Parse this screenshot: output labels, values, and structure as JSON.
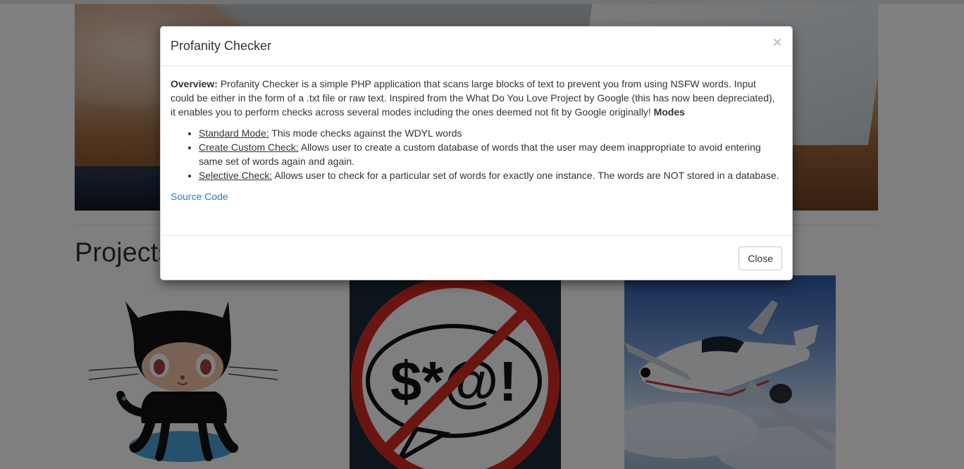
{
  "background": {
    "section_title": "Projects",
    "hero_image": "desk-workspace-image",
    "cards": [
      {
        "image": "github-octocat-image"
      },
      {
        "image": "profanity-no-swearing-image",
        "symbol_text": "$*@!"
      },
      {
        "image": "jet-airplane-image"
      }
    ]
  },
  "modal": {
    "title": "Profanity Checker",
    "close_icon": "×",
    "overview_label": "Overview:",
    "overview_text": " Profanity Checker is a simple PHP application that scans large blocks of text to prevent you from using NSFW words. Input could be either in the form of a .txt file or raw text. Inspired from the What Do You Love Project by Google (this has now been depreciated), it enables you to perform checks across several modes including the ones deemed not fit by Google originally! ",
    "modes_label": "Modes",
    "modes": [
      {
        "name": "Standard Mode:",
        "description": " This mode checks against the WDYL words"
      },
      {
        "name": "Create Custom Check:",
        "description": " Allows user to create a custom database of words that the user may deem inappropriate to avoid entering same set of words again and again."
      },
      {
        "name": "Selective Check:",
        "description": " Allows user to check for a particular set of words for exactly one instance. The words are NOT stored in a database."
      }
    ],
    "source_link": "Source Code",
    "close_button": "Close"
  },
  "colors": {
    "link": "#337ab7",
    "backdrop": "rgba(0,0,0,0.5)",
    "no_sign_red": "#d42a22"
  }
}
